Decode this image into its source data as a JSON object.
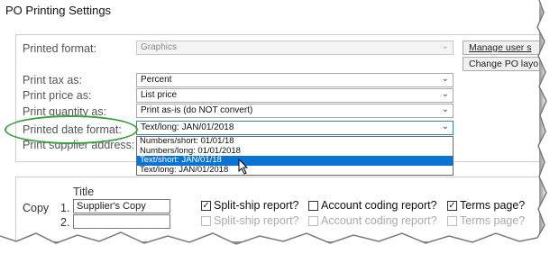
{
  "window": {
    "title": "PO Printing Settings"
  },
  "labels": {
    "printed_format": "Printed format:",
    "print_tax_as": "Print tax as:",
    "print_price_as": "Print price as:",
    "print_quantity_as": "Print quantity as:",
    "printed_date_format": "Printed date format:",
    "print_supplier_address": "Print supplier address:"
  },
  "fields": {
    "printed_format": "Graphics",
    "print_tax_as": "Percent",
    "print_price_as": "List price",
    "print_quantity_as": "Print as-is (do NOT convert)",
    "printed_date_format": "Text/long: JAN/01/2018"
  },
  "buttons": {
    "manage_user": "Manage user s",
    "change_po_layout": "Change PO layo"
  },
  "date_format_options": [
    "Numbers/short: 01/01/18",
    "Numbers/long: 01/01/2018",
    "Text/short: JAN/01/18",
    "Text/long: JAN/01/2018"
  ],
  "selected_option_index": 2,
  "copies": {
    "copy_label": "Copy",
    "title_header": "Title",
    "rows": [
      {
        "number": "1.",
        "title": "Supplier's Copy",
        "split_ship": "Split-ship report?",
        "account_coding": "Account coding report?",
        "terms": "Terms page?"
      },
      {
        "number": "2.",
        "title": "",
        "split_ship": "Split-ship report?",
        "account_coding": "Account coding report?",
        "terms": "Terms page?"
      }
    ]
  },
  "colors": {
    "highlight_oval": "#3aa040",
    "selection": "#0a74d6"
  }
}
